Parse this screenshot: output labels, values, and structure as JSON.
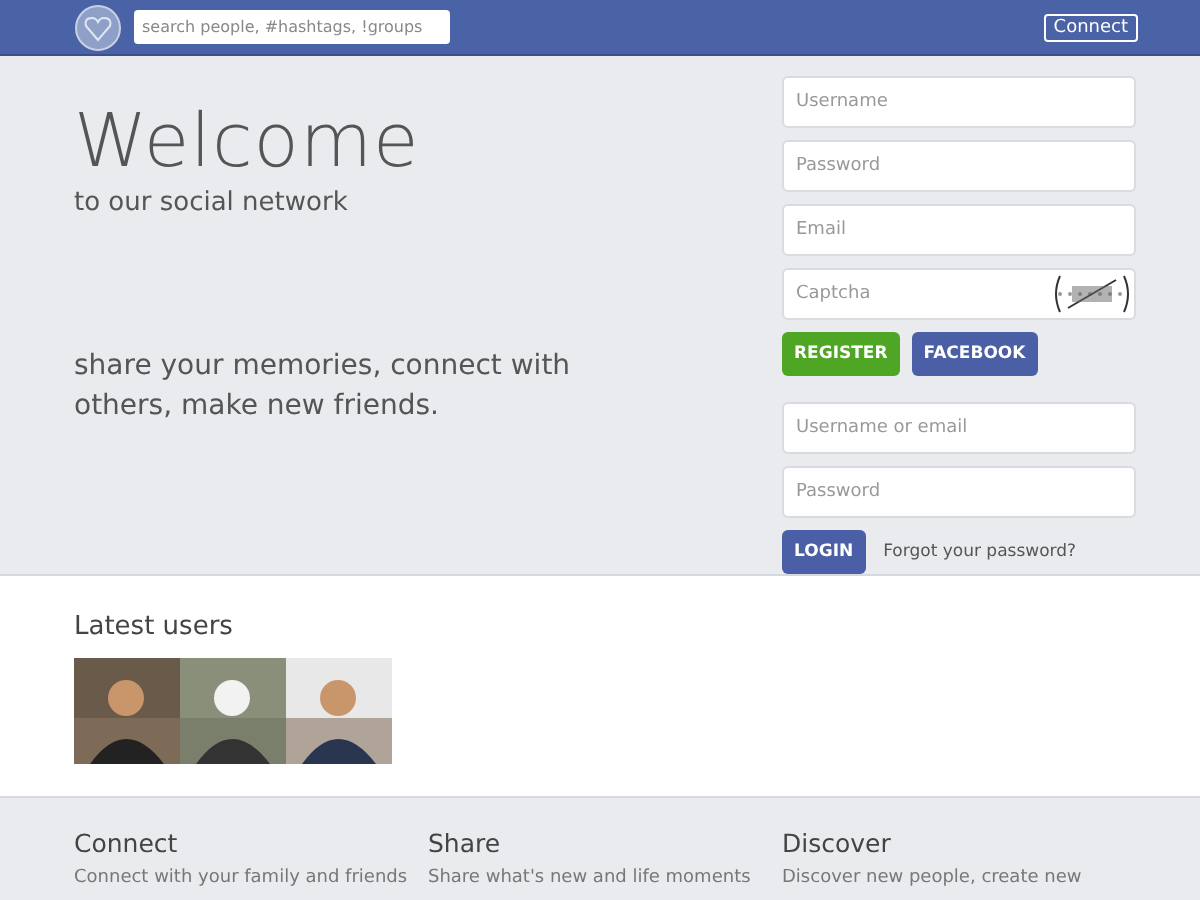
{
  "header": {
    "search": {
      "placeholder": "search people, #hashtags, !groups"
    },
    "connect_button": "Connect"
  },
  "hero": {
    "title": "Welcome",
    "subtitle": "to our social network",
    "tagline": "share your memories, connect with others, make new friends."
  },
  "register_form": {
    "fields": [
      {
        "placeholder": "Username",
        "kind": "text"
      },
      {
        "placeholder": "Password",
        "kind": "text"
      },
      {
        "placeholder": "Email",
        "kind": "text"
      },
      {
        "placeholder": "Captcha",
        "kind": "captcha"
      }
    ],
    "buttons": [
      {
        "label": "REGISTER",
        "color": "#4ea624"
      },
      {
        "label": "FACEBOOK",
        "color": "#4a5fa5"
      }
    ]
  },
  "login_form": {
    "fields": [
      {
        "placeholder": "Username or email"
      },
      {
        "placeholder": "Password"
      }
    ],
    "button": "LOGIN",
    "forgot_link": "Forgot your password?"
  },
  "latest_users": {
    "title": "Latest users"
  },
  "footer": {
    "columns": [
      {
        "title": "Connect",
        "text": "Connect with your family and friends"
      },
      {
        "title": "Share",
        "text": "Share what's new and life moments"
      },
      {
        "title": "Discover",
        "text": "Discover new people, create new"
      }
    ]
  }
}
